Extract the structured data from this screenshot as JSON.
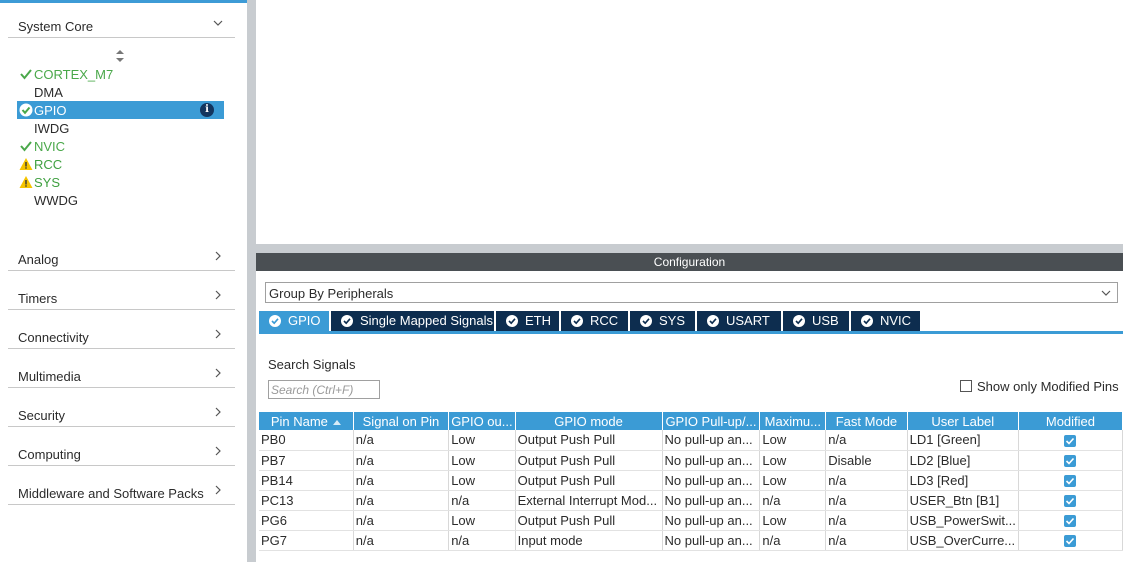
{
  "sidebar": {
    "system_core": {
      "label": "System Core",
      "items": [
        {
          "label": "CORTEX_M7",
          "status": "check"
        },
        {
          "label": "DMA",
          "status": "none"
        },
        {
          "label": "GPIO",
          "status": "check-selected"
        },
        {
          "label": "IWDG",
          "status": "none"
        },
        {
          "label": "NVIC",
          "status": "check"
        },
        {
          "label": "RCC",
          "status": "warning"
        },
        {
          "label": "SYS",
          "status": "warning"
        },
        {
          "label": "WWDG",
          "status": "none"
        }
      ],
      "info_glyph": "i"
    },
    "categories": [
      {
        "label": "Analog"
      },
      {
        "label": "Timers"
      },
      {
        "label": "Connectivity"
      },
      {
        "label": "Multimedia"
      },
      {
        "label": "Security"
      },
      {
        "label": "Computing"
      },
      {
        "label": "Middleware and Software Packs"
      }
    ]
  },
  "config": {
    "title": "Configuration",
    "group_by": "Group By Peripherals",
    "tabs": [
      {
        "label": "GPIO",
        "active": true
      },
      {
        "label": "Single Mapped Signals",
        "active": false
      },
      {
        "label": "ETH",
        "active": false
      },
      {
        "label": "RCC",
        "active": false
      },
      {
        "label": "SYS",
        "active": false
      },
      {
        "label": "USART",
        "active": false
      },
      {
        "label": "USB",
        "active": false
      },
      {
        "label": "NVIC",
        "active": false
      }
    ],
    "search_label": "Search Signals",
    "search_placeholder": "Search (Ctrl+F)",
    "show_modified_label": "Show only Modified Pins",
    "table": {
      "headers": [
        "Pin Name",
        "Signal on Pin",
        "GPIO ou...",
        "GPIO mode",
        "GPIO Pull-up/...",
        "Maximu...",
        "Fast Mode",
        "User Label",
        "Modified"
      ],
      "rows": [
        [
          "PB0",
          "n/a",
          "Low",
          "Output Push Pull",
          "No pull-up an...",
          "Low",
          "n/a",
          "LD1 [Green]",
          true
        ],
        [
          "PB7",
          "n/a",
          "Low",
          "Output Push Pull",
          "No pull-up an...",
          "Low",
          "Disable",
          "LD2 [Blue]",
          true
        ],
        [
          "PB14",
          "n/a",
          "Low",
          "Output Push Pull",
          "No pull-up an...",
          "Low",
          "n/a",
          "LD3 [Red]",
          true
        ],
        [
          "PC13",
          "n/a",
          "n/a",
          "External Interrupt Mod...",
          "No pull-up an...",
          "n/a",
          "n/a",
          "USER_Btn [B1]",
          true
        ],
        [
          "PG6",
          "n/a",
          "Low",
          "Output Push Pull",
          "No pull-up an...",
          "Low",
          "n/a",
          "USB_PowerSwit...",
          true
        ],
        [
          "PG7",
          "n/a",
          "n/a",
          "Input mode",
          "No pull-up an...",
          "n/a",
          "n/a",
          "USB_OverCurre...",
          true
        ]
      ]
    }
  },
  "colors": {
    "accent": "#3b9bd5",
    "tab_dark": "#0d2d4f",
    "title_bar": "#4a4f53",
    "check_green": "#4aa84a",
    "warning_yellow": "#f5c400"
  }
}
